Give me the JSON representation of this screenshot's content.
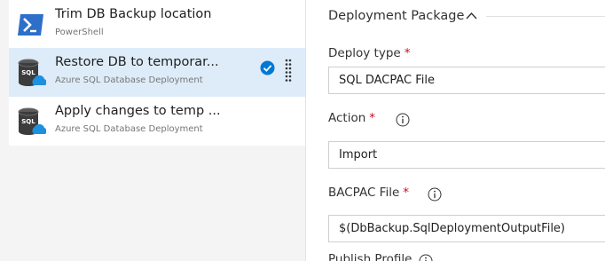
{
  "tasks": [
    {
      "title": "Trim DB Backup location",
      "subtitle": "PowerShell",
      "icon": "powershell-icon"
    },
    {
      "title": "Restore DB to temporar...",
      "subtitle": "Azure SQL Database Deployment",
      "icon": "azure-sql-icon"
    },
    {
      "title": "Apply changes to temp ...",
      "subtitle": "Azure SQL Database Deployment",
      "icon": "azure-sql-icon"
    }
  ],
  "panel": {
    "section_title": "Deployment Package",
    "fields": {
      "deploy_type": {
        "label": "Deploy type",
        "required": "*",
        "value": "SQL DACPAC File"
      },
      "action": {
        "label": "Action",
        "required": "*",
        "value": "Import"
      },
      "bacpac_file": {
        "label": "BACPAC File",
        "required": "*",
        "value": "$(DbBackup.SqlDeploymentOutputFile)"
      },
      "publish_profile": {
        "label": "Publish Profile"
      }
    }
  },
  "colors": {
    "selected_bg": "#deecf9",
    "accent": "#0078d4",
    "required": "#c50f1f",
    "powershell": "#2d6fc9"
  }
}
